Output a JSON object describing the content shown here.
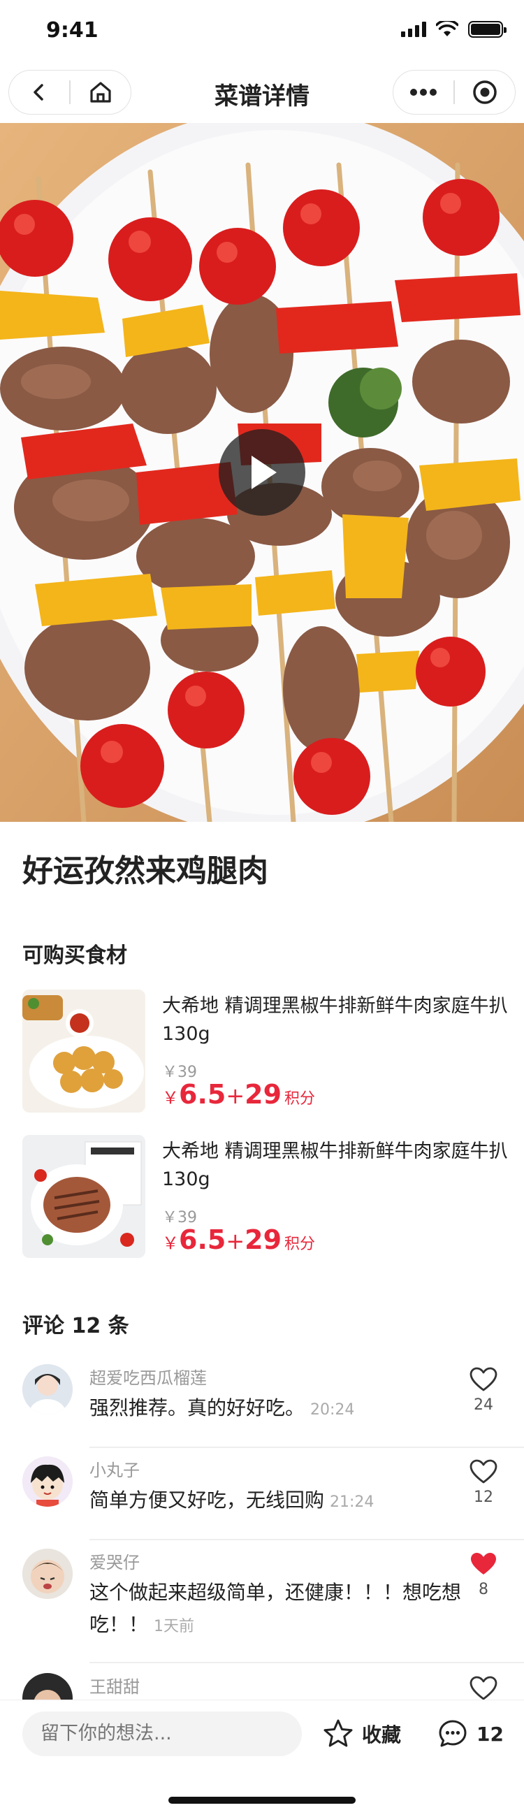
{
  "status_bar": {
    "time": "9:41"
  },
  "nav": {
    "title": "菜谱详情"
  },
  "recipe": {
    "title": "好运孜然来鸡腿肉"
  },
  "ingredients": {
    "section_title": "可购买食材",
    "items": [
      {
        "name": "大希地 精调理黑椒牛排新鲜牛肉家庭牛扒130g",
        "original_price": "￥39",
        "currency": "￥",
        "price": "6.5",
        "plus": "+",
        "points": "29",
        "points_label": "积分"
      },
      {
        "name": "大希地 精调理黑椒牛排新鲜牛肉家庭牛扒130g",
        "original_price": "￥39",
        "currency": "￥",
        "price": "6.5",
        "plus": "+",
        "points": "29",
        "points_label": "积分"
      }
    ]
  },
  "comments": {
    "section_title": "评论 12 条",
    "items": [
      {
        "user": "超爱吃西瓜榴莲",
        "text": "强烈推荐。真的好好吃。",
        "time": "20:24",
        "likes": "24",
        "liked": false
      },
      {
        "user": "小丸子",
        "text": "简单方便又好吃，无线回购",
        "time": "21:24",
        "likes": "12",
        "liked": false
      },
      {
        "user": "爱哭仔",
        "text": "这个做起来超级简单，还健康！！！想吃想吃！！",
        "time": "1天前",
        "likes": "8",
        "liked": true
      },
      {
        "user": "王甜甜",
        "text": "",
        "time": "",
        "likes": "",
        "liked": false
      }
    ]
  },
  "bottom_bar": {
    "input_placeholder": "留下你的想法...",
    "favorite_label": "收藏",
    "comment_count": "12"
  },
  "colors": {
    "accent_red": "#e8273b",
    "text_primary": "#222222",
    "text_secondary": "#999999"
  },
  "icons": [
    "back-icon",
    "home-icon",
    "more-icon",
    "target-icon",
    "play-icon",
    "heart-outline-icon",
    "heart-filled-icon",
    "star-icon",
    "comment-icon"
  ]
}
